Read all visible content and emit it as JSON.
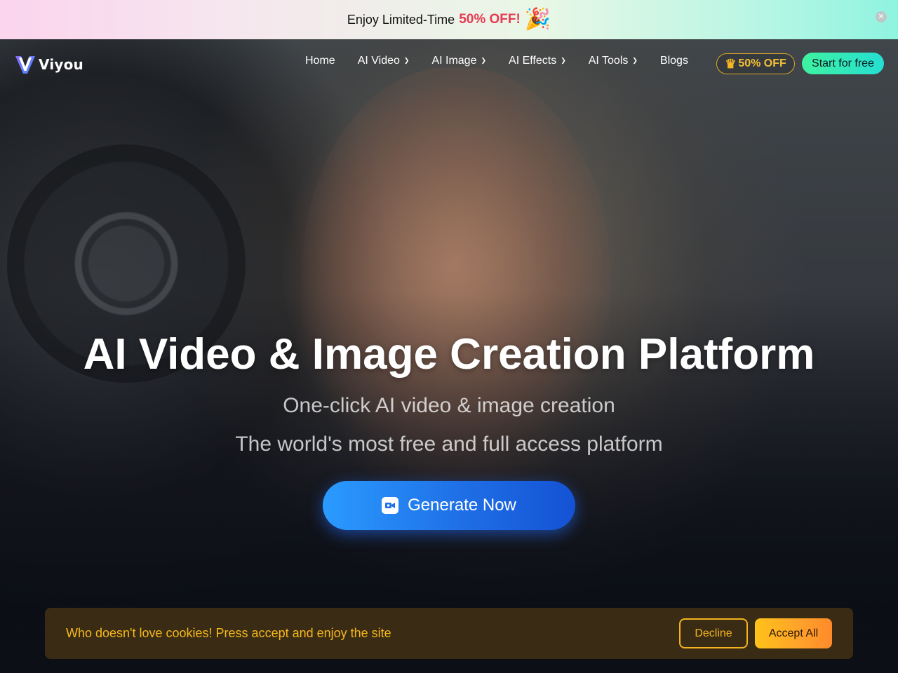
{
  "promo": {
    "text": "Enjoy Limited-Time",
    "highlight": "50% OFF!",
    "party_icon": "party-popper-icon",
    "close_icon": "close-icon"
  },
  "nav": {
    "logo_text": "Viyou",
    "items": [
      {
        "label": "Home",
        "dropdown": false
      },
      {
        "label": "AI Video",
        "dropdown": true
      },
      {
        "label": "AI Image",
        "dropdown": true
      },
      {
        "label": "AI Effects",
        "dropdown": true
      },
      {
        "label": "AI Tools",
        "dropdown": true
      },
      {
        "label": "Blogs",
        "dropdown": false
      }
    ],
    "deal_label": "50% OFF",
    "start_label": "Start for free"
  },
  "hero": {
    "title": "AI Video & Image Creation Platform",
    "subtitle_1": "One-click AI video & image creation",
    "subtitle_2": "The world's most free and full access platform",
    "cta_label": "Generate Now"
  },
  "cookie": {
    "message": "Who doesn't love cookies! Press accept and enjoy the site",
    "decline_label": "Decline",
    "accept_label": "Accept All"
  },
  "colors": {
    "promo_accent": "#e63a52",
    "deal_gold": "#f4c037",
    "start_gradient_from": "#3ff2a0",
    "start_gradient_to": "#25dfd3",
    "cta_blue": "#1f6fe6",
    "cookie_bg": "#3a2c14",
    "cookie_text": "#f6b81c"
  }
}
